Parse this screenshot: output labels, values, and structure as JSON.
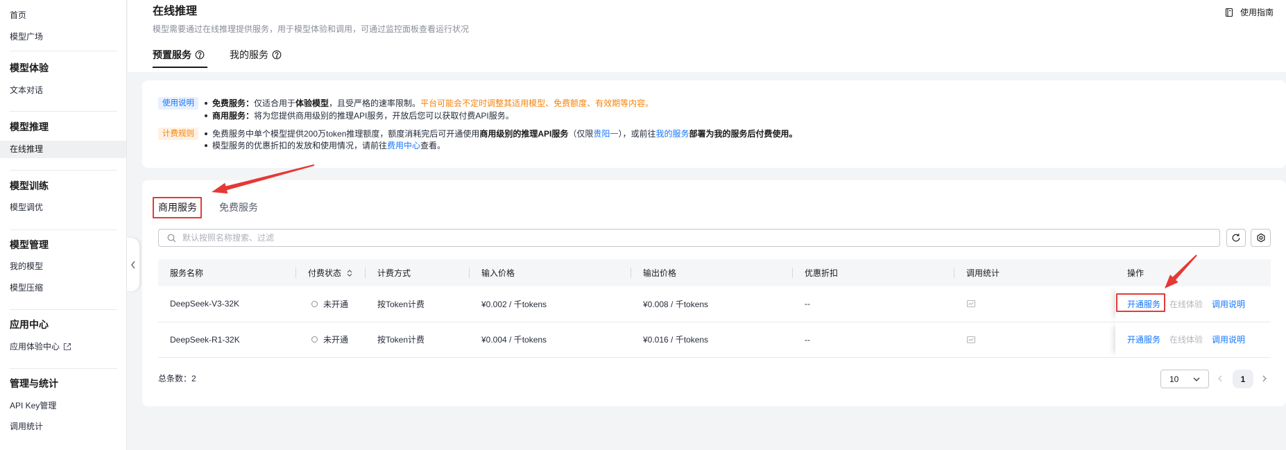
{
  "colors": {
    "accent": "#1476ff",
    "warning": "#f5840c",
    "annotation": "#e53935",
    "disabled": "#b4b7bd",
    "usage_tag_bg": "#e8f1ff",
    "billing_tag_bg": "#fff1e3",
    "billing_tag_text": "#f5840c"
  },
  "sidebar": {
    "top_items": [
      {
        "label": "首页"
      },
      {
        "label": "模型广场"
      }
    ],
    "groups": [
      {
        "title": "模型体验",
        "items": [
          {
            "label": "文本对话",
            "selected": false
          }
        ]
      },
      {
        "title": "模型推理",
        "items": [
          {
            "label": "在线推理",
            "selected": true
          }
        ]
      },
      {
        "title": "模型训练",
        "items": [
          {
            "label": "模型调优",
            "selected": false
          }
        ]
      },
      {
        "title": "模型管理",
        "items": [
          {
            "label": "我的模型",
            "selected": false
          },
          {
            "label": "模型压缩",
            "selected": false
          }
        ]
      },
      {
        "title": "应用中心",
        "items": [
          {
            "label": "应用体验中心",
            "selected": false,
            "icon": "external-link-icon"
          }
        ]
      },
      {
        "title": "管理与统计",
        "items": [
          {
            "label": "API Key管理",
            "selected": false
          },
          {
            "label": "调用统计",
            "selected": false
          }
        ]
      }
    ]
  },
  "header": {
    "title": "在线推理",
    "subtitle": "模型需要通过在线推理提供服务，用于模型体验和调用，可通过监控面板查看运行状况",
    "guide_label": "使用指南"
  },
  "page_tabs": [
    {
      "label": "预置服务",
      "selected": true
    },
    {
      "label": "我的服务",
      "selected": false
    }
  ],
  "notice": {
    "usage_tag": "使用说明",
    "free_service": {
      "label": "免费服务：",
      "text_1": "仅适合用于",
      "highlight": "体验模型",
      "text_2": "，且受严格的速率限制。",
      "warning": "平台可能会不定时调整其适用模型、免费额度、有效期等内容。"
    },
    "commercial_service": {
      "label": "商用服务：",
      "text": "将为您提供商用级别的推理API服务，开放后您可以获取付费API服务。"
    },
    "billing_tag": "计费规则",
    "quota_rule": {
      "text_1": "免费服务中单个模型提供200万token推理额度，额度消耗完后可开通使用",
      "highlight": "商用级别的推理API服务",
      "text_2": "（仅限",
      "region_link": "贵阳一",
      "text_3": "），或前往",
      "my_service_link": "我的服务",
      "highlight_2": "部署为我的服务后付费使用。"
    },
    "discount_rule": {
      "text_1": "模型服务的优惠折扣的发放和使用情况，请前往",
      "billing_center_link": "费用中心",
      "text_2": "查看。"
    }
  },
  "service_tabs": [
    {
      "label": "商用服务",
      "selected": true
    },
    {
      "label": "免费服务",
      "selected": false
    }
  ],
  "search": {
    "placeholder": "默认按照名称搜索、过滤",
    "value": ""
  },
  "table": {
    "columns": [
      "服务名称",
      "付费状态",
      "计费方式",
      "输入价格",
      "输出价格",
      "优惠折扣",
      "调用统计",
      "操作"
    ],
    "rows": [
      {
        "name": "DeepSeek-V3-32K",
        "status": "未开通",
        "billing": "按Token计费",
        "input_price": "¥0.002 / 千tokens",
        "output_price": "¥0.008 / 千tokens",
        "discount": "--",
        "actions": [
          {
            "label": "开通服务",
            "enabled": true
          },
          {
            "label": "在线体验",
            "enabled": false
          },
          {
            "label": "调用说明",
            "enabled": true
          }
        ]
      },
      {
        "name": "DeepSeek-R1-32K",
        "status": "未开通",
        "billing": "按Token计费",
        "input_price": "¥0.004 / 千tokens",
        "output_price": "¥0.016 / 千tokens",
        "discount": "--",
        "actions": [
          {
            "label": "开通服务",
            "enabled": true
          },
          {
            "label": "在线体验",
            "enabled": false
          },
          {
            "label": "调用说明",
            "enabled": true
          }
        ]
      }
    ]
  },
  "pagination": {
    "total_label": "总条数：",
    "total": "2",
    "page_size": "10",
    "current_page": "1"
  }
}
